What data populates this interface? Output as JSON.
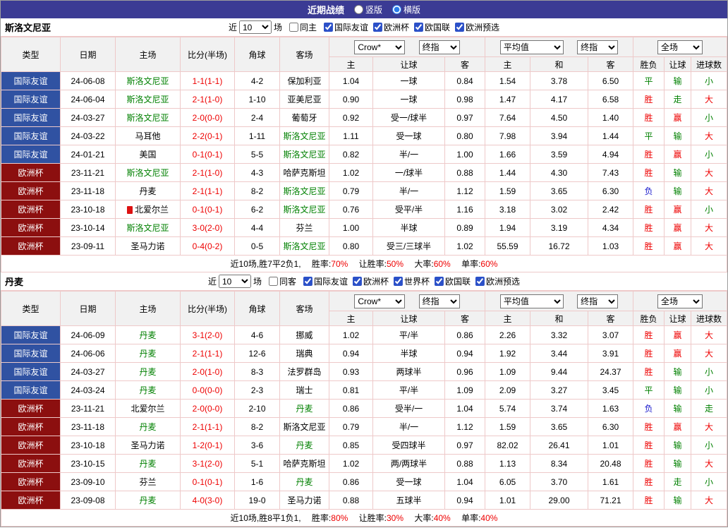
{
  "palette": {
    "topbar_bg": "#3b3b94",
    "type_friendly_bg": "#3052a2",
    "type_eurocup_bg": "#8c0f0f",
    "focus_team": "#008000",
    "score": "#ee0000",
    "win": "#ee0000",
    "draw": "#008000",
    "loss": "#1717cc",
    "border": "#eec9c9",
    "header_bg": "#f1f1f1"
  },
  "top_bar": {
    "title": "近期战绩",
    "layout_options": [
      {
        "label": "竖版",
        "checked": false
      },
      {
        "label": "横版",
        "checked": true
      }
    ]
  },
  "columns": {
    "static": [
      "类型",
      "日期",
      "主场",
      "比分(半场)",
      "角球",
      "客场"
    ],
    "sub": [
      "主",
      "让球",
      "客",
      "主",
      "和",
      "客",
      "胜负",
      "让球",
      "进球数"
    ],
    "selects": {
      "company": "Crow*",
      "company_time": "终指",
      "average": "平均值",
      "average_time": "终指",
      "scope": "全场"
    }
  },
  "sections": [
    {
      "team": "斯洛文尼亚",
      "filter": {
        "recent_label": "近",
        "count": "10",
        "games_label": "场",
        "same_venue": {
          "label": "同主",
          "checked": false
        },
        "competitions": [
          {
            "label": "国际友谊",
            "checked": true
          },
          {
            "label": "欧洲杯",
            "checked": true
          },
          {
            "label": "欧国联",
            "checked": true
          },
          {
            "label": "欧洲预选",
            "checked": true
          }
        ]
      },
      "rows": [
        {
          "type": "国际友谊",
          "type_key": "friendly",
          "date": "24-06-08",
          "home": "斯洛文尼亚",
          "home_focus": true,
          "home_icon": false,
          "score": "1-1(1-1)",
          "corners": "4-2",
          "away": "保加利亚",
          "away_focus": false,
          "odds": [
            "1.04",
            "一球",
            "0.84"
          ],
          "avg": [
            "1.54",
            "3.78",
            "6.50"
          ],
          "wdl": {
            "t": "平",
            "c": "green"
          },
          "hcp": {
            "t": "输",
            "c": "green"
          },
          "goal": {
            "t": "小",
            "c": "green"
          }
        },
        {
          "type": "国际友谊",
          "type_key": "friendly",
          "date": "24-06-04",
          "home": "斯洛文尼亚",
          "home_focus": true,
          "home_icon": false,
          "score": "2-1(1-0)",
          "corners": "1-10",
          "away": "亚美尼亚",
          "away_focus": false,
          "odds": [
            "0.90",
            "一球",
            "0.98"
          ],
          "avg": [
            "1.47",
            "4.17",
            "6.58"
          ],
          "wdl": {
            "t": "胜",
            "c": "red"
          },
          "hcp": {
            "t": "走",
            "c": "green"
          },
          "goal": {
            "t": "大",
            "c": "red"
          }
        },
        {
          "type": "国际友谊",
          "type_key": "friendly",
          "date": "24-03-27",
          "home": "斯洛文尼亚",
          "home_focus": true,
          "home_icon": false,
          "score": "2-0(0-0)",
          "corners": "2-4",
          "away": "葡萄牙",
          "away_focus": false,
          "odds": [
            "0.92",
            "受一/球半",
            "0.97"
          ],
          "avg": [
            "7.64",
            "4.50",
            "1.40"
          ],
          "wdl": {
            "t": "胜",
            "c": "red"
          },
          "hcp": {
            "t": "赢",
            "c": "red"
          },
          "goal": {
            "t": "小",
            "c": "green"
          }
        },
        {
          "type": "国际友谊",
          "type_key": "friendly",
          "date": "24-03-22",
          "home": "马耳他",
          "home_focus": false,
          "home_icon": false,
          "score": "2-2(0-1)",
          "corners": "1-11",
          "away": "斯洛文尼亚",
          "away_focus": true,
          "odds": [
            "1.11",
            "受一球",
            "0.80"
          ],
          "avg": [
            "7.98",
            "3.94",
            "1.44"
          ],
          "wdl": {
            "t": "平",
            "c": "green"
          },
          "hcp": {
            "t": "输",
            "c": "green"
          },
          "goal": {
            "t": "大",
            "c": "red"
          }
        },
        {
          "type": "国际友谊",
          "type_key": "friendly",
          "date": "24-01-21",
          "home": "美国",
          "home_focus": false,
          "home_icon": false,
          "score": "0-1(0-1)",
          "corners": "5-5",
          "away": "斯洛文尼亚",
          "away_focus": true,
          "odds": [
            "0.82",
            "半/一",
            "1.00"
          ],
          "avg": [
            "1.66",
            "3.59",
            "4.94"
          ],
          "wdl": {
            "t": "胜",
            "c": "red"
          },
          "hcp": {
            "t": "赢",
            "c": "red"
          },
          "goal": {
            "t": "小",
            "c": "green"
          }
        },
        {
          "type": "欧洲杯",
          "type_key": "eurocup",
          "date": "23-11-21",
          "home": "斯洛文尼亚",
          "home_focus": true,
          "home_icon": false,
          "score": "2-1(1-0)",
          "corners": "4-3",
          "away": "哈萨克斯坦",
          "away_focus": false,
          "odds": [
            "1.02",
            "一/球半",
            "0.88"
          ],
          "avg": [
            "1.44",
            "4.30",
            "7.43"
          ],
          "wdl": {
            "t": "胜",
            "c": "red"
          },
          "hcp": {
            "t": "输",
            "c": "green"
          },
          "goal": {
            "t": "大",
            "c": "red"
          }
        },
        {
          "type": "欧洲杯",
          "type_key": "eurocup",
          "date": "23-11-18",
          "home": "丹麦",
          "home_focus": false,
          "home_icon": false,
          "score": "2-1(1-1)",
          "corners": "8-2",
          "away": "斯洛文尼亚",
          "away_focus": true,
          "odds": [
            "0.79",
            "半/一",
            "1.12"
          ],
          "avg": [
            "1.59",
            "3.65",
            "6.30"
          ],
          "wdl": {
            "t": "负",
            "c": "blue"
          },
          "hcp": {
            "t": "输",
            "c": "green"
          },
          "goal": {
            "t": "大",
            "c": "red"
          }
        },
        {
          "type": "欧洲杯",
          "type_key": "eurocup",
          "date": "23-10-18",
          "home": "北爱尔兰",
          "home_focus": false,
          "home_icon": true,
          "score": "0-1(0-1)",
          "corners": "6-2",
          "away": "斯洛文尼亚",
          "away_focus": true,
          "odds": [
            "0.76",
            "受平/半",
            "1.16"
          ],
          "avg": [
            "3.18",
            "3.02",
            "2.42"
          ],
          "wdl": {
            "t": "胜",
            "c": "red"
          },
          "hcp": {
            "t": "赢",
            "c": "red"
          },
          "goal": {
            "t": "小",
            "c": "green"
          }
        },
        {
          "type": "欧洲杯",
          "type_key": "eurocup",
          "date": "23-10-14",
          "home": "斯洛文尼亚",
          "home_focus": true,
          "home_icon": false,
          "score": "3-0(2-0)",
          "corners": "4-4",
          "away": "芬兰",
          "away_focus": false,
          "odds": [
            "1.00",
            "半球",
            "0.89"
          ],
          "avg": [
            "1.94",
            "3.19",
            "4.34"
          ],
          "wdl": {
            "t": "胜",
            "c": "red"
          },
          "hcp": {
            "t": "赢",
            "c": "red"
          },
          "goal": {
            "t": "大",
            "c": "red"
          }
        },
        {
          "type": "欧洲杯",
          "type_key": "eurocup",
          "date": "23-09-11",
          "home": "圣马力诺",
          "home_focus": false,
          "home_icon": false,
          "score": "0-4(0-2)",
          "corners": "0-5",
          "away": "斯洛文尼亚",
          "away_focus": true,
          "odds": [
            "0.80",
            "受三/三球半",
            "1.02"
          ],
          "avg": [
            "55.59",
            "16.72",
            "1.03"
          ],
          "wdl": {
            "t": "胜",
            "c": "red"
          },
          "hcp": {
            "t": "赢",
            "c": "red"
          },
          "goal": {
            "t": "大",
            "c": "red"
          }
        }
      ],
      "summary": {
        "prefix": "近10场,胜7平2负1,",
        "stats": [
          {
            "label": "胜率:",
            "value": "70%"
          },
          {
            "label": "让胜率:",
            "value": "50%"
          },
          {
            "label": "大率:",
            "value": "60%"
          },
          {
            "label": "单率:",
            "value": "60%"
          }
        ]
      }
    },
    {
      "team": "丹麦",
      "filter": {
        "recent_label": "近",
        "count": "10",
        "games_label": "场",
        "same_venue": {
          "label": "同客",
          "checked": false
        },
        "competitions": [
          {
            "label": "国际友谊",
            "checked": true
          },
          {
            "label": "欧洲杯",
            "checked": true
          },
          {
            "label": "世界杯",
            "checked": true
          },
          {
            "label": "欧国联",
            "checked": true
          },
          {
            "label": "欧洲预选",
            "checked": true
          }
        ]
      },
      "rows": [
        {
          "type": "国际友谊",
          "type_key": "friendly",
          "date": "24-06-09",
          "home": "丹麦",
          "home_focus": true,
          "home_icon": false,
          "score": "3-1(2-0)",
          "corners": "4-6",
          "away": "挪威",
          "away_focus": false,
          "odds": [
            "1.02",
            "平/半",
            "0.86"
          ],
          "avg": [
            "2.26",
            "3.32",
            "3.07"
          ],
          "wdl": {
            "t": "胜",
            "c": "red"
          },
          "hcp": {
            "t": "赢",
            "c": "red"
          },
          "goal": {
            "t": "大",
            "c": "red"
          }
        },
        {
          "type": "国际友谊",
          "type_key": "friendly",
          "date": "24-06-06",
          "home": "丹麦",
          "home_focus": true,
          "home_icon": false,
          "score": "2-1(1-1)",
          "corners": "12-6",
          "away": "瑞典",
          "away_focus": false,
          "odds": [
            "0.94",
            "半球",
            "0.94"
          ],
          "avg": [
            "1.92",
            "3.44",
            "3.91"
          ],
          "wdl": {
            "t": "胜",
            "c": "red"
          },
          "hcp": {
            "t": "赢",
            "c": "red"
          },
          "goal": {
            "t": "大",
            "c": "red"
          }
        },
        {
          "type": "国际友谊",
          "type_key": "friendly",
          "date": "24-03-27",
          "home": "丹麦",
          "home_focus": true,
          "home_icon": false,
          "score": "2-0(1-0)",
          "corners": "8-3",
          "away": "法罗群岛",
          "away_focus": false,
          "odds": [
            "0.93",
            "两球半",
            "0.96"
          ],
          "avg": [
            "1.09",
            "9.44",
            "24.37"
          ],
          "wdl": {
            "t": "胜",
            "c": "red"
          },
          "hcp": {
            "t": "输",
            "c": "green"
          },
          "goal": {
            "t": "小",
            "c": "green"
          }
        },
        {
          "type": "国际友谊",
          "type_key": "friendly",
          "date": "24-03-24",
          "home": "丹麦",
          "home_focus": true,
          "home_icon": false,
          "score": "0-0(0-0)",
          "corners": "2-3",
          "away": "瑞士",
          "away_focus": false,
          "odds": [
            "0.81",
            "平/半",
            "1.09"
          ],
          "avg": [
            "2.09",
            "3.27",
            "3.45"
          ],
          "wdl": {
            "t": "平",
            "c": "green"
          },
          "hcp": {
            "t": "输",
            "c": "green"
          },
          "goal": {
            "t": "小",
            "c": "green"
          }
        },
        {
          "type": "欧洲杯",
          "type_key": "eurocup",
          "date": "23-11-21",
          "home": "北爱尔兰",
          "home_focus": false,
          "home_icon": false,
          "score": "2-0(0-0)",
          "corners": "2-10",
          "away": "丹麦",
          "away_focus": true,
          "odds": [
            "0.86",
            "受半/一",
            "1.04"
          ],
          "avg": [
            "5.74",
            "3.74",
            "1.63"
          ],
          "wdl": {
            "t": "负",
            "c": "blue"
          },
          "hcp": {
            "t": "输",
            "c": "green"
          },
          "goal": {
            "t": "走",
            "c": "green"
          }
        },
        {
          "type": "欧洲杯",
          "type_key": "eurocup",
          "date": "23-11-18",
          "home": "丹麦",
          "home_focus": true,
          "home_icon": false,
          "score": "2-1(1-1)",
          "corners": "8-2",
          "away": "斯洛文尼亚",
          "away_focus": false,
          "odds": [
            "0.79",
            "半/一",
            "1.12"
          ],
          "avg": [
            "1.59",
            "3.65",
            "6.30"
          ],
          "wdl": {
            "t": "胜",
            "c": "red"
          },
          "hcp": {
            "t": "赢",
            "c": "red"
          },
          "goal": {
            "t": "大",
            "c": "red"
          }
        },
        {
          "type": "欧洲杯",
          "type_key": "eurocup",
          "date": "23-10-18",
          "home": "圣马力诺",
          "home_focus": false,
          "home_icon": false,
          "score": "1-2(0-1)",
          "corners": "3-6",
          "away": "丹麦",
          "away_focus": true,
          "odds": [
            "0.85",
            "受四球半",
            "0.97"
          ],
          "avg": [
            "82.02",
            "26.41",
            "1.01"
          ],
          "wdl": {
            "t": "胜",
            "c": "red"
          },
          "hcp": {
            "t": "输",
            "c": "green"
          },
          "goal": {
            "t": "小",
            "c": "green"
          }
        },
        {
          "type": "欧洲杯",
          "type_key": "eurocup",
          "date": "23-10-15",
          "home": "丹麦",
          "home_focus": true,
          "home_icon": false,
          "score": "3-1(2-0)",
          "corners": "5-1",
          "away": "哈萨克斯坦",
          "away_focus": false,
          "odds": [
            "1.02",
            "两/两球半",
            "0.88"
          ],
          "avg": [
            "1.13",
            "8.34",
            "20.48"
          ],
          "wdl": {
            "t": "胜",
            "c": "red"
          },
          "hcp": {
            "t": "输",
            "c": "green"
          },
          "goal": {
            "t": "大",
            "c": "red"
          }
        },
        {
          "type": "欧洲杯",
          "type_key": "eurocup",
          "date": "23-09-10",
          "home": "芬兰",
          "home_focus": false,
          "home_icon": false,
          "score": "0-1(0-1)",
          "corners": "1-6",
          "away": "丹麦",
          "away_focus": true,
          "odds": [
            "0.86",
            "受一球",
            "1.04"
          ],
          "avg": [
            "6.05",
            "3.70",
            "1.61"
          ],
          "wdl": {
            "t": "胜",
            "c": "red"
          },
          "hcp": {
            "t": "走",
            "c": "green"
          },
          "goal": {
            "t": "小",
            "c": "green"
          }
        },
        {
          "type": "欧洲杯",
          "type_key": "eurocup",
          "date": "23-09-08",
          "home": "丹麦",
          "home_focus": true,
          "home_icon": false,
          "score": "4-0(3-0)",
          "corners": "19-0",
          "away": "圣马力诺",
          "away_focus": false,
          "odds": [
            "0.88",
            "五球半",
            "0.94"
          ],
          "avg": [
            "1.01",
            "29.00",
            "71.21"
          ],
          "wdl": {
            "t": "胜",
            "c": "red"
          },
          "hcp": {
            "t": "输",
            "c": "green"
          },
          "goal": {
            "t": "大",
            "c": "red"
          }
        }
      ],
      "summary": {
        "prefix": "近10场,胜8平1负1,",
        "stats": [
          {
            "label": "胜率:",
            "value": "80%"
          },
          {
            "label": "让胜率:",
            "value": "30%"
          },
          {
            "label": "大率:",
            "value": "40%"
          },
          {
            "label": "单率:",
            "value": "40%"
          }
        ]
      }
    }
  ]
}
